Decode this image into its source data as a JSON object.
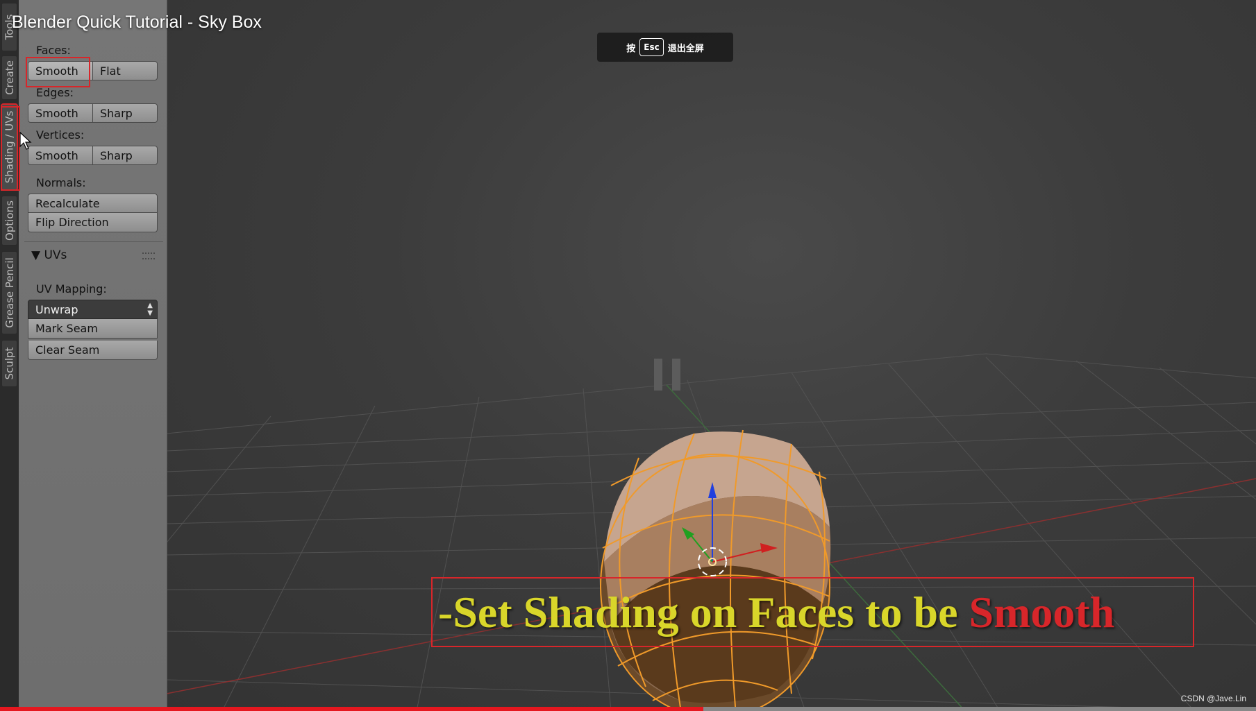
{
  "video": {
    "title": "Blender Quick Tutorial - Sky Box",
    "fullscreen_hint": {
      "prefix": "按",
      "key": "Esc",
      "suffix": "退出全屏"
    },
    "progress_fraction": 0.56,
    "watermark": "CSDN @Jave.Lin",
    "pause_icon": "pause-icon"
  },
  "tabs": [
    {
      "label": "Tools"
    },
    {
      "label": "Create"
    },
    {
      "label": "Shading / UVs",
      "active": true
    },
    {
      "label": "Options"
    },
    {
      "label": "Grease Pencil"
    },
    {
      "label": "Sculpt"
    }
  ],
  "shading": {
    "faces_label": "Faces:",
    "faces_smooth": "Smooth",
    "faces_flat": "Flat",
    "edges_label": "Edges:",
    "edges_smooth": "Smooth",
    "edges_sharp": "Sharp",
    "vertices_label": "Vertices:",
    "vertices_smooth": "Smooth",
    "vertices_sharp": "Sharp",
    "normals_label": "Normals:",
    "recalculate": "Recalculate",
    "flip_direction": "Flip Direction"
  },
  "uvs": {
    "header": "▼ UVs",
    "mapping_label": "UV Mapping:",
    "unwrap": "Unwrap",
    "mark_seam": "Mark Seam",
    "clear_seam": "Clear Seam"
  },
  "caption": {
    "main": "-Set Shading on Faces to be",
    "highlight": "Smooth",
    "main_color": "#d9d62a",
    "highlight_color": "#d8262a"
  },
  "colors": {
    "annotation_red": "#d8262a",
    "object_orange": "#f0a030",
    "axis_x": "#d02020",
    "axis_y": "#20a020",
    "axis_z": "#2040e0"
  }
}
